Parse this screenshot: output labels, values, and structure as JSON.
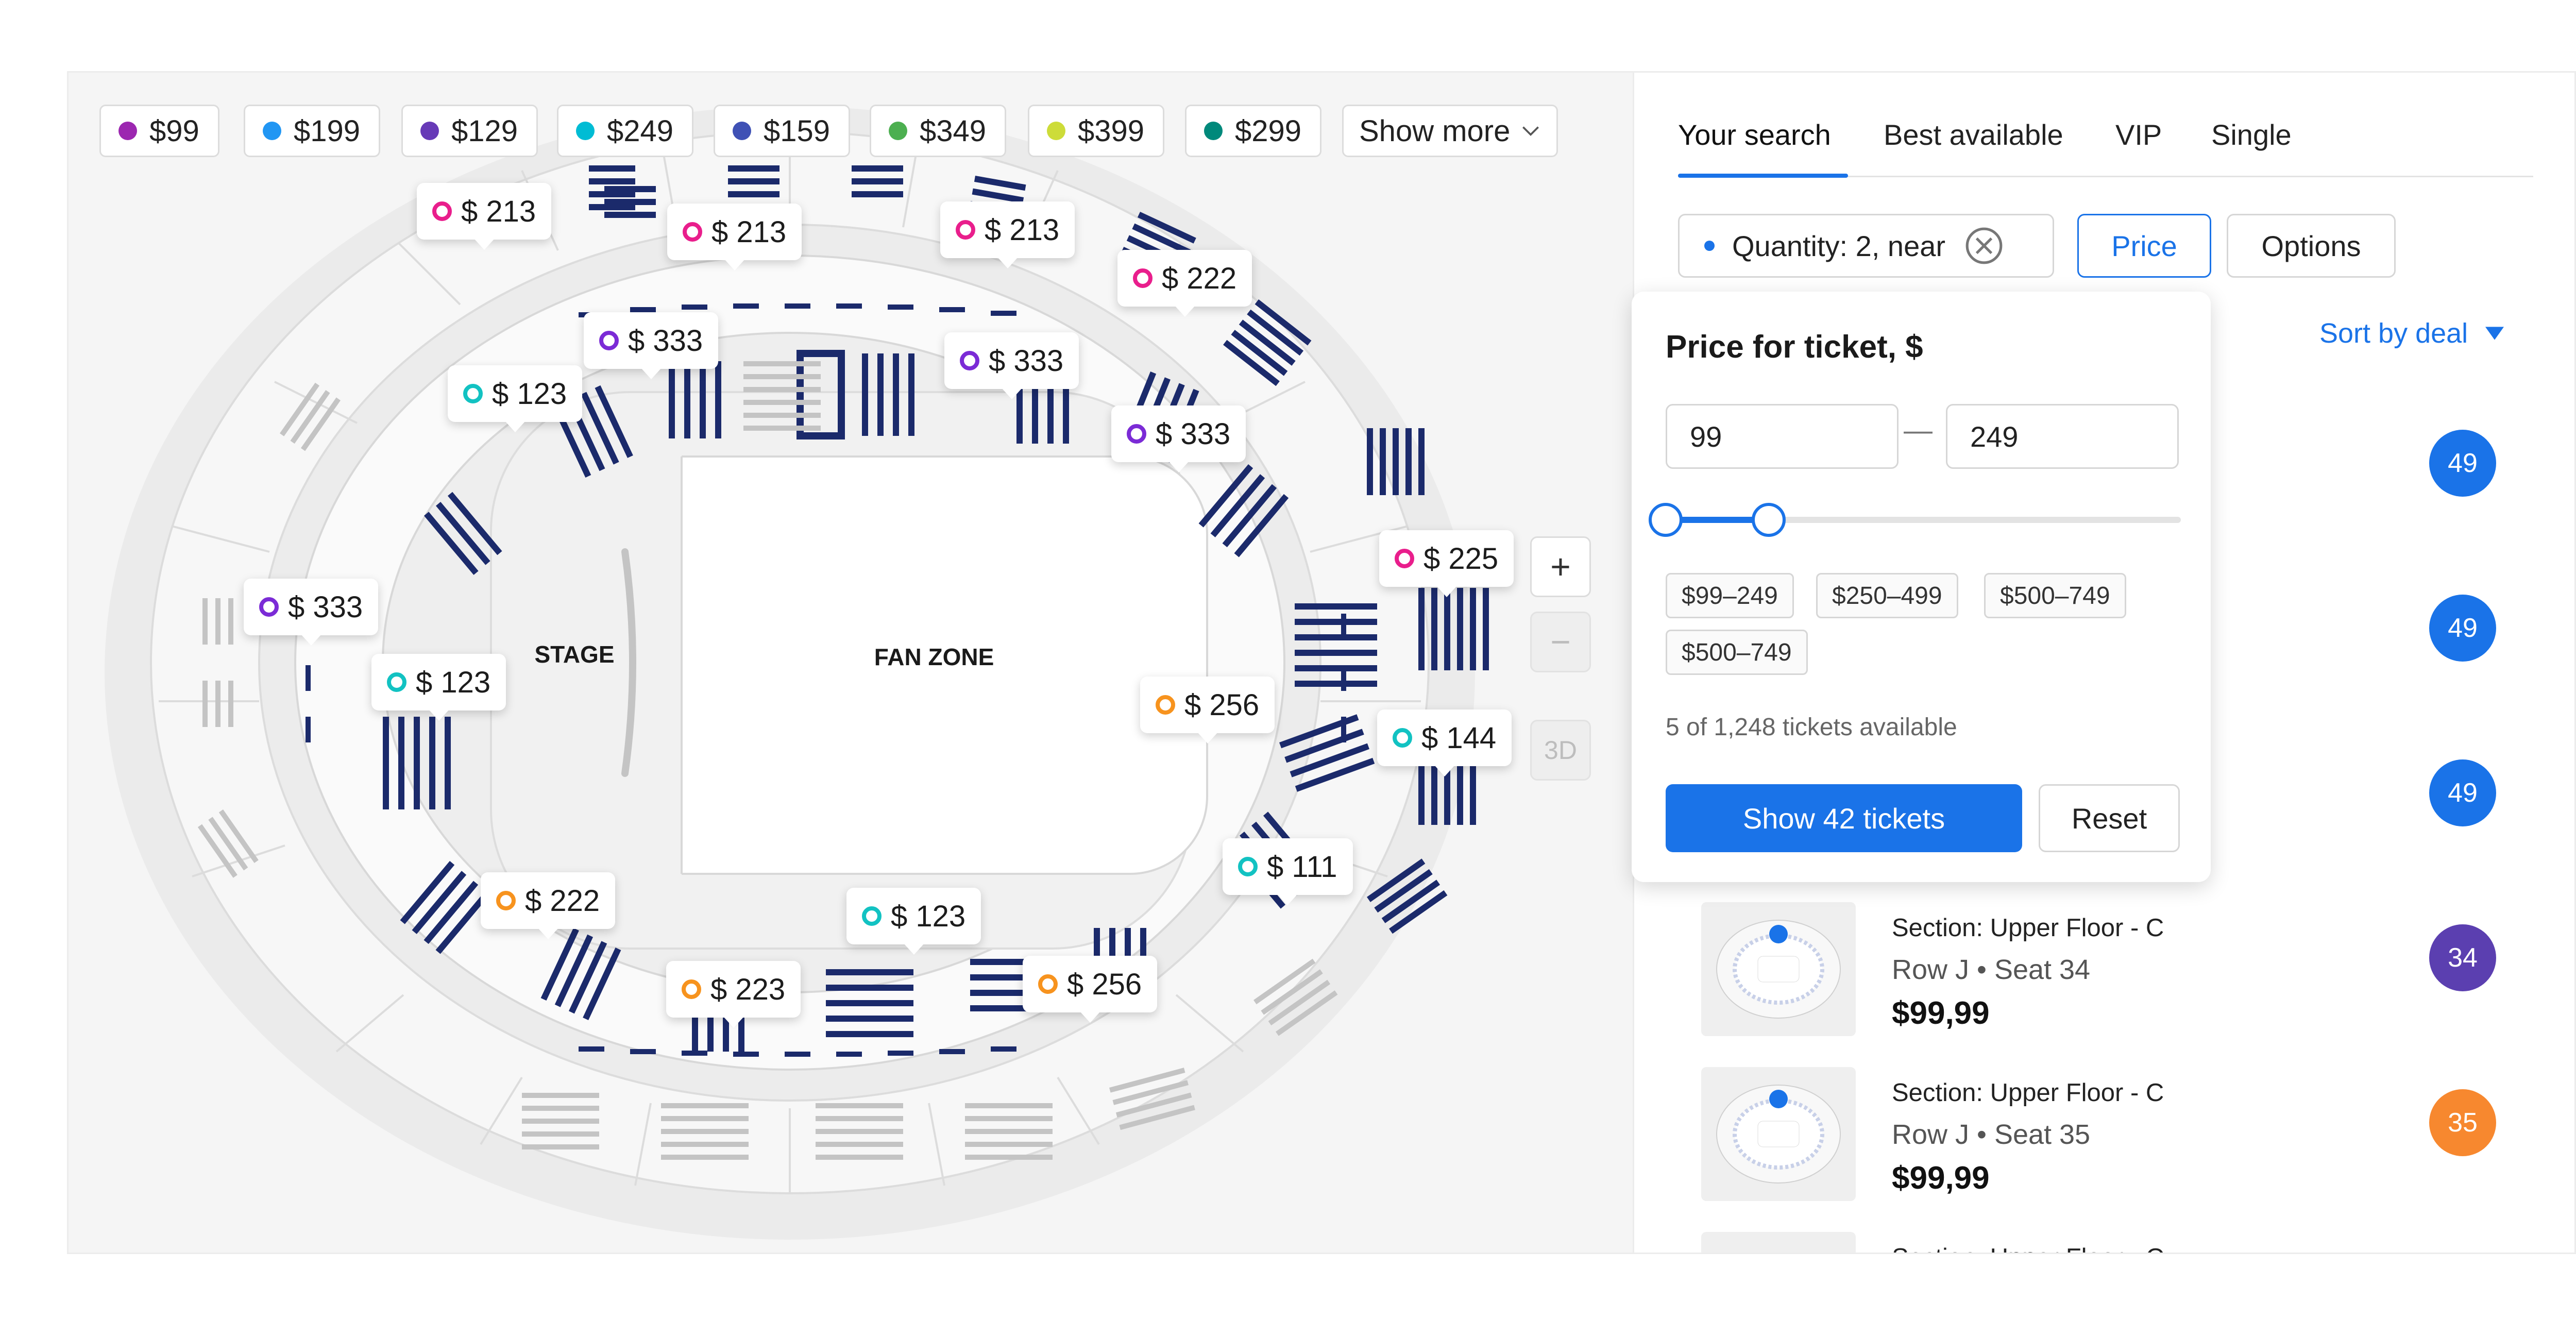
{
  "legend": {
    "items": [
      {
        "label": "$99",
        "color": "#9c27b0"
      },
      {
        "label": "$199",
        "color": "#2196f3"
      },
      {
        "label": "$129",
        "color": "#673ab7"
      },
      {
        "label": "$249",
        "color": "#00bcd4"
      },
      {
        "label": "$159",
        "color": "#3f51b5"
      },
      {
        "label": "$349",
        "color": "#4caf50"
      },
      {
        "label": "$399",
        "color": "#cddc39"
      },
      {
        "label": "$299",
        "color": "#00897b"
      }
    ],
    "show_more_label": "Show more"
  },
  "map": {
    "stage_label": "STAGE",
    "fan_zone_label": "FAN ZONE",
    "zoom_in_label": "+",
    "zoom_out_label": "−",
    "three_d_label": "3D",
    "price_pins": [
      {
        "label": "$ 213",
        "color": "#e91e8c"
      },
      {
        "label": "$ 213",
        "color": "#e91e8c"
      },
      {
        "label": "$ 213",
        "color": "#e91e8c"
      },
      {
        "label": "$ 222",
        "color": "#e91e8c"
      },
      {
        "label": "$ 333",
        "color": "#7b2bd6"
      },
      {
        "label": "$ 333",
        "color": "#7b2bd6"
      },
      {
        "label": "$ 123",
        "color": "#12c2c2"
      },
      {
        "label": "$ 333",
        "color": "#7b2bd6"
      },
      {
        "label": "$ 225",
        "color": "#e91e8c"
      },
      {
        "label": "$ 333",
        "color": "#7b2bd6"
      },
      {
        "label": "$ 123",
        "color": "#12c2c2"
      },
      {
        "label": "$ 256",
        "color": "#f7931e"
      },
      {
        "label": "$ 144",
        "color": "#12c2c2"
      },
      {
        "label": "$ 111",
        "color": "#12c2c2"
      },
      {
        "label": "$ 222",
        "color": "#f7931e"
      },
      {
        "label": "$ 123",
        "color": "#12c2c2"
      },
      {
        "label": "$ 223",
        "color": "#f7931e"
      },
      {
        "label": "$ 256",
        "color": "#f7931e"
      }
    ]
  },
  "sidebar": {
    "tabs": [
      {
        "label": "Your search",
        "active": true
      },
      {
        "label": "Best available",
        "active": false
      },
      {
        "label": "VIP",
        "active": false
      },
      {
        "label": "Single",
        "active": false
      }
    ],
    "filters": {
      "quantity_label": "Quantity: 2, near",
      "price_label": "Price",
      "options_label": "Options"
    },
    "sort_label": "Sort by deal",
    "listings": [
      {
        "badge": "49",
        "badge_color": "#1a73e8"
      },
      {
        "badge": "49",
        "badge_color": "#1a73e8"
      },
      {
        "badge": "49",
        "badge_color": "#1a73e8"
      },
      {
        "section": "Section: Upper Floor - C",
        "row_seat": "Row J • Seat 34",
        "price": "$99,99",
        "badge": "34",
        "badge_color": "#5b3fb0"
      },
      {
        "section": "Section: Upper Floor - C",
        "row_seat": "Row J • Seat 35",
        "price": "$99,99",
        "badge": "35",
        "badge_color": "#f7882f"
      },
      {
        "section": "Section: Upper Floor - C"
      }
    ]
  },
  "price_popover": {
    "title": "Price for ticket, $",
    "min_value": "99",
    "max_value": "249",
    "separator": "—",
    "slider_min_fraction": 0,
    "slider_max_fraction": 0.2,
    "ranges": [
      "$99–249",
      "$250–499",
      "$500–749",
      "$500–749"
    ],
    "availability": "5 of 1,248 tickets available",
    "show_button": "Show 42 tickets",
    "reset_button": "Reset"
  }
}
